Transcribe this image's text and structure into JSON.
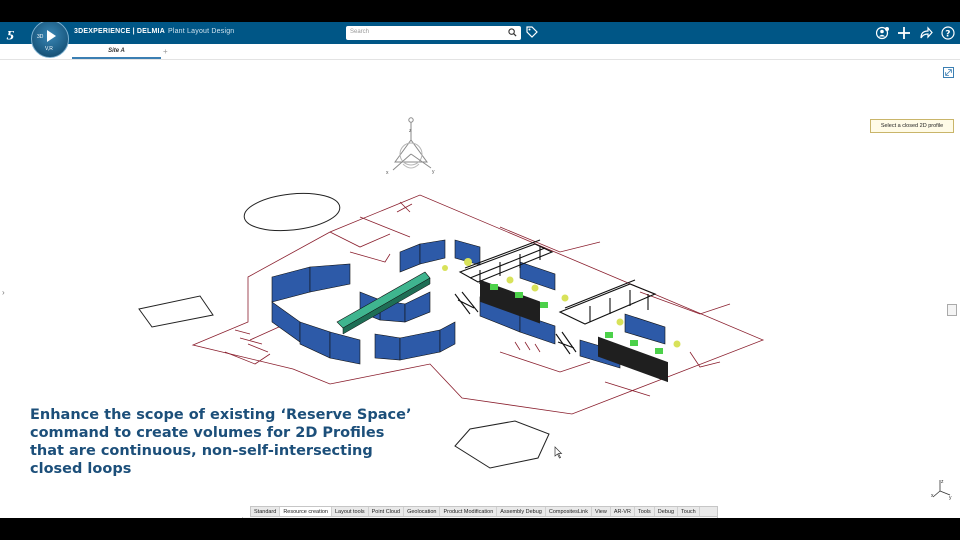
{
  "header": {
    "brand_bold": "3DEXPERIENCE | DELMIA",
    "subtitle": "Plant Layout Design",
    "compass_3d": "3D",
    "compass_vr": "V,R",
    "search_placeholder": "Search"
  },
  "tabs": [
    {
      "label": "Site A"
    }
  ],
  "tooltip": "Select a closed 2D profile",
  "caption": {
    "line1": "Enhance the scope of existing ‘Reserve Space’",
    "line2": "command to create volumes for 2D Profiles",
    "line3": "that are continuous, non-self-intersecting",
    "line4": "closed loops"
  },
  "toolbar_tabs": [
    "Standard",
    "Resource creation",
    "Layout tools",
    "Point Cloud",
    "Geolocation",
    "Product Modification",
    "Assembly Debug",
    "CompositesLink",
    "View",
    "AR-VR",
    "Tools",
    "Debug",
    "Touch"
  ],
  "toolbar_active_tab": "Resource creation",
  "toolbar_icons": [
    "cut-icon",
    "copy-icon",
    "paste-icon",
    "undo-icon",
    "update-icon",
    "catalog-icon",
    "resource-icon",
    "edit-icon",
    "snap-icon",
    "globe-icon",
    "measure-icon",
    "zone-icon",
    "box-icon",
    "robot-icon",
    "flow-icon",
    "tag-tool-icon",
    "analyze-icon",
    "screen-icon",
    "more-icon"
  ],
  "compass_labels": {
    "z": "z",
    "x": "x",
    "y": "y"
  },
  "colors": {
    "header_bg": "#005686",
    "caption": "#1c4f7a",
    "fence": "#2d5aa8",
    "conveyor": "#3fb58f",
    "floor_outline": "#8a1f2e",
    "machine": "#4cd14a"
  }
}
